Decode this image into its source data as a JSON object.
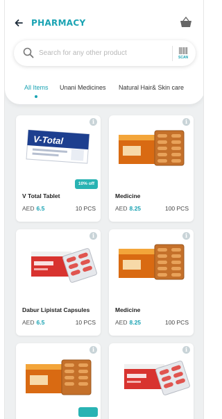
{
  "header": {
    "title": "PHARMACY",
    "back_icon": "arrow-left-icon",
    "basket_icon": "basket-icon"
  },
  "search": {
    "placeholder": "Search for any other product",
    "value": "",
    "scan_label": "SCAN"
  },
  "tabs": [
    {
      "label": "All Items",
      "active": true
    },
    {
      "label": "Unani Medicines",
      "active": false
    },
    {
      "label": "Natural Hair& Skin care",
      "active": false
    }
  ],
  "colors": {
    "accent": "#1aa3b3",
    "offer_badge": "#29b3b3",
    "background": "#eef0f1"
  },
  "products": [
    {
      "name": "V Total Tablet",
      "currency": "AED",
      "price": "6.5",
      "qty": "10 PCS",
      "offer": "10% off",
      "image": "vtotal-box"
    },
    {
      "name": "Medicine",
      "currency": "AED",
      "price": "8.25",
      "qty": "100 PCS",
      "offer": "",
      "image": "orange-capsule-box"
    },
    {
      "name": "Dabur Lipistat Capsules",
      "currency": "AED",
      "price": "6.5",
      "qty": "10 PCS",
      "offer": "",
      "image": "red-lipistat-box"
    },
    {
      "name": "Medicine",
      "currency": "AED",
      "price": "8.25",
      "qty": "100 PCS",
      "offer": "",
      "image": "orange-capsule-box"
    },
    {
      "name": "",
      "currency": "",
      "price": "",
      "qty": "",
      "offer": "",
      "image": "orange-capsule-box"
    },
    {
      "name": "",
      "currency": "",
      "price": "",
      "qty": "",
      "offer": "",
      "image": "red-lipistat-box"
    }
  ]
}
